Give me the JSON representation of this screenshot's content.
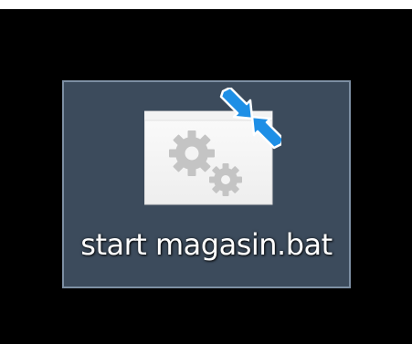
{
  "desktop": {
    "background_color": "#000000",
    "selected_icon": {
      "label": "start magasin.bat",
      "selection_fill": "#3c4b5c",
      "selection_border": "#7d8fa3",
      "icon_type": "batch-file-gears-icon",
      "overlay_icon": "compress-arrows-icon",
      "overlay_color": "#1e8fe6"
    }
  }
}
